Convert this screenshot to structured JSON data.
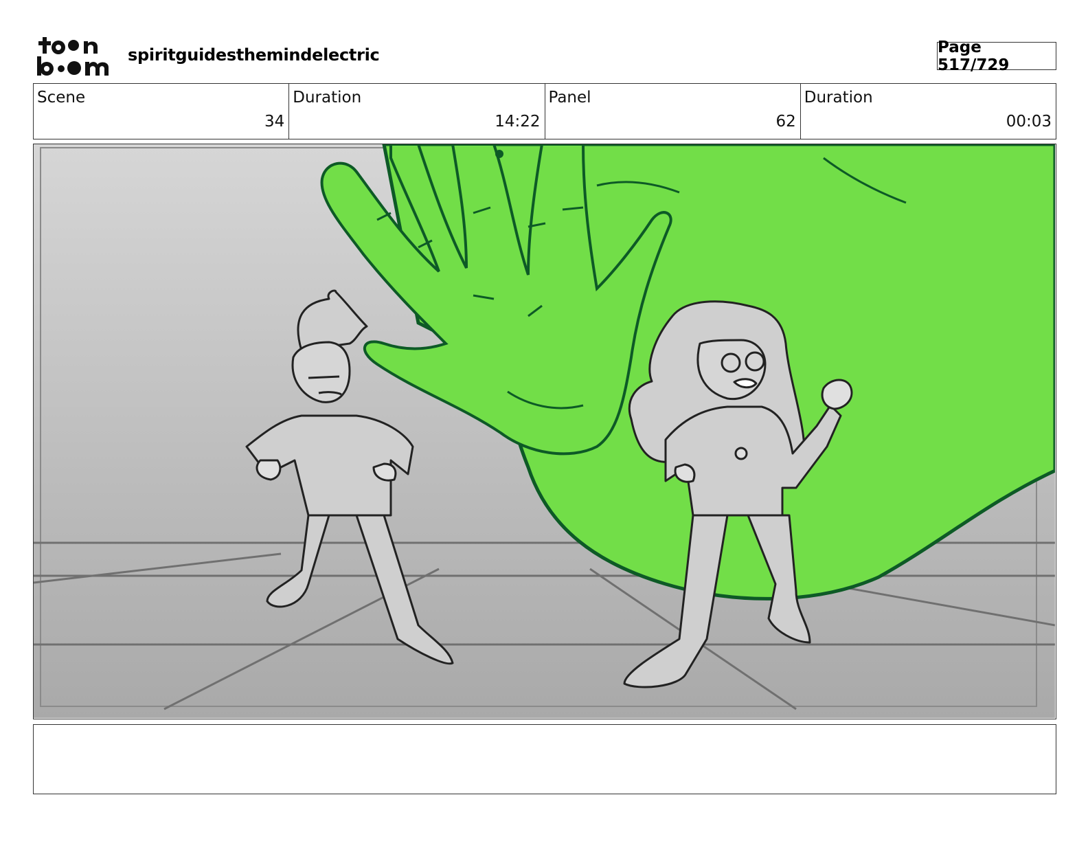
{
  "header": {
    "logo_alt": "toon boom",
    "project_title": "spiritguidesthemindelectric",
    "page_label": "Page 517/729"
  },
  "info": {
    "scene_label": "Scene",
    "scene_value": "34",
    "scene_duration_label": "Duration",
    "scene_duration_value": "14:22",
    "panel_label": "Panel",
    "panel_value": "62",
    "panel_duration_label": "Duration",
    "panel_duration_value": "00:03"
  },
  "notes": {
    "text": ""
  },
  "colors": {
    "accent_green": "#72de48",
    "outline_green": "#0d5a26",
    "floor_gray": "#b3b3b3",
    "line_dark": "#222222"
  }
}
